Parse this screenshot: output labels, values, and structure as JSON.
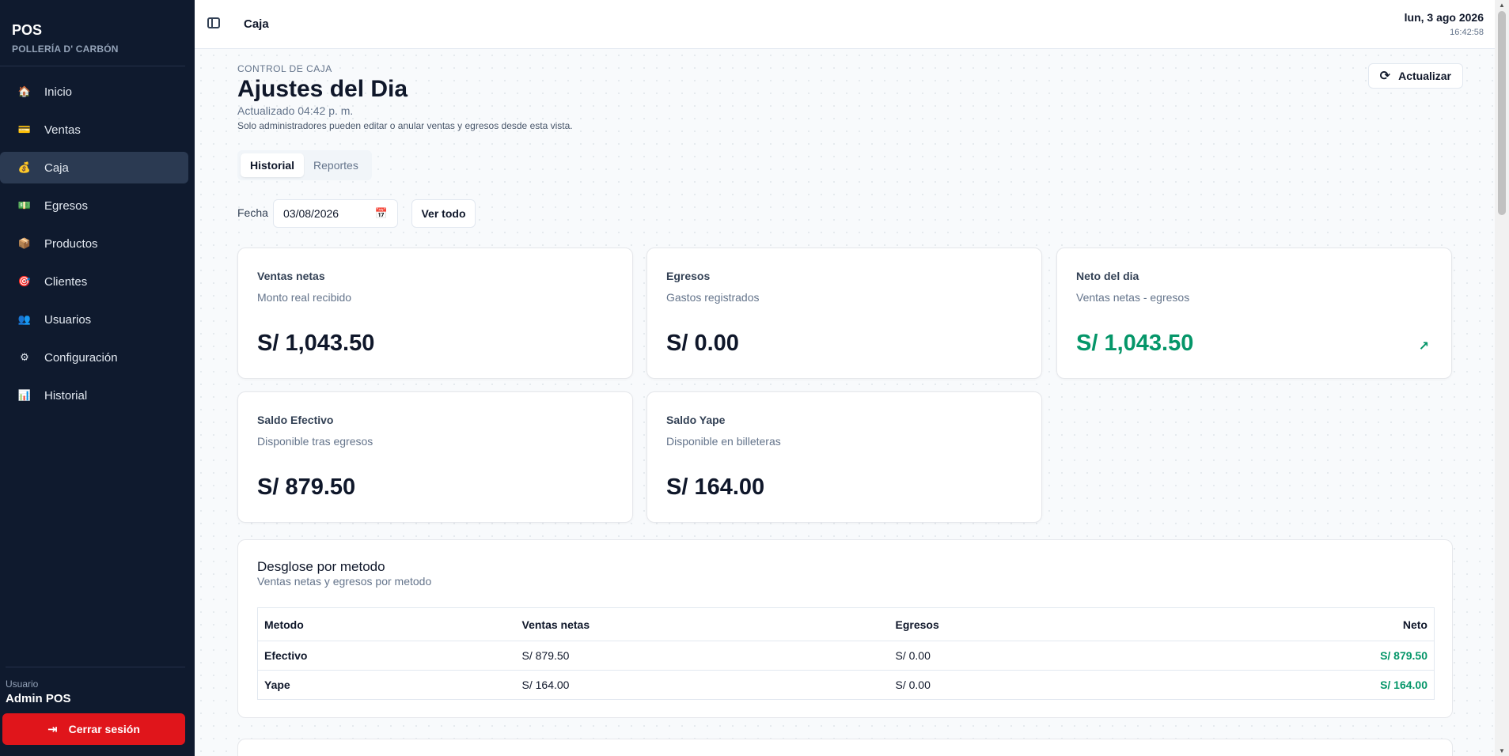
{
  "app": {
    "title": "POS",
    "subtitle": "POLLERÍA D' CARBÓN"
  },
  "sidebar": {
    "items": [
      {
        "label": "Inicio",
        "icon": "🏠"
      },
      {
        "label": "Ventas",
        "icon": "💳"
      },
      {
        "label": "Caja",
        "icon": "💰"
      },
      {
        "label": "Egresos",
        "icon": "💵"
      },
      {
        "label": "Productos",
        "icon": "📦"
      },
      {
        "label": "Clientes",
        "icon": "🎯"
      },
      {
        "label": "Usuarios",
        "icon": "👥"
      },
      {
        "label": "Configuración",
        "icon": "⚙"
      },
      {
        "label": "Historial",
        "icon": "📊"
      }
    ],
    "user_label": "Usuario",
    "user_name": "Admin POS",
    "logout_label": "Cerrar sesión"
  },
  "topbar": {
    "title": "Caja",
    "date": "lun, 3 ago 2026",
    "time": "16:42:58"
  },
  "page": {
    "eyebrow": "CONTROL DE CAJA",
    "title": "Ajustes del Dia",
    "updated": "Actualizado 04:42 p. m.",
    "note": "Solo administradores pueden editar o anular ventas y egresos desde esta vista.",
    "refresh_label": "Actualizar"
  },
  "tabs": [
    {
      "label": "Historial",
      "active": true
    },
    {
      "label": "Reportes",
      "active": false
    }
  ],
  "filter": {
    "label": "Fecha",
    "date_value": "03/08/2026",
    "ver_todo": "Ver todo"
  },
  "cards": [
    {
      "title": "Ventas netas",
      "desc": "Monto real recibido",
      "value": "S/ 1,043.50"
    },
    {
      "title": "Egresos",
      "desc": "Gastos registrados",
      "value": "S/ 0.00"
    },
    {
      "title": "Neto del dia",
      "desc": "Ventas netas - egresos",
      "value": "S/ 1,043.50",
      "trend_icon": "↗"
    },
    {
      "title": "Saldo Efectivo",
      "desc": "Disponible tras egresos",
      "value": "S/ 879.50"
    },
    {
      "title": "Saldo Yape",
      "desc": "Disponible en billeteras",
      "value": "S/ 164.00"
    }
  ],
  "breakdown": {
    "title": "Desglose por metodo",
    "subtitle": "Ventas netas y egresos por metodo",
    "headers": [
      "Metodo",
      "Ventas netas",
      "Egresos",
      "Neto"
    ],
    "rows": [
      [
        "Efectivo",
        "S/ 879.50",
        "S/ 0.00",
        "S/ 879.50"
      ],
      [
        "Yape",
        "S/ 164.00",
        "S/ 0.00",
        "S/ 164.00"
      ]
    ]
  },
  "colors": {
    "sidebar_bg": "#0f1a2e",
    "accent_green": "#059669",
    "danger": "#e0151b"
  }
}
